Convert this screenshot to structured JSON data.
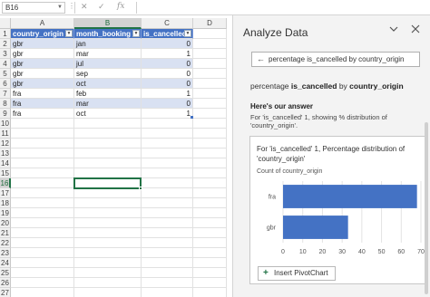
{
  "formula_bar": {
    "name_box": "B16",
    "more": "⋮",
    "cancel_icon": "✕",
    "enter_icon": "✓",
    "fx_label": "fx",
    "formula": ""
  },
  "columns": [
    "A",
    "B",
    "C",
    "D"
  ],
  "rows": [
    "1",
    "2",
    "3",
    "4",
    "5",
    "6",
    "7",
    "8",
    "9",
    "10",
    "11",
    "12",
    "13",
    "14",
    "15",
    "16",
    "17",
    "18",
    "19",
    "20",
    "21",
    "22",
    "23",
    "24",
    "25",
    "26",
    "27"
  ],
  "table": {
    "headers": [
      "country_origin",
      "month_booking",
      "is_cancelled"
    ],
    "data": [
      [
        "gbr",
        "jan",
        "0"
      ],
      [
        "gbr",
        "mar",
        "1"
      ],
      [
        "gbr",
        "jul",
        "0"
      ],
      [
        "gbr",
        "sep",
        "0"
      ],
      [
        "gbr",
        "oct",
        "0"
      ],
      [
        "fra",
        "feb",
        "1"
      ],
      [
        "fra",
        "mar",
        "0"
      ],
      [
        "fra",
        "oct",
        "1"
      ]
    ]
  },
  "active_cell": "B16",
  "pane": {
    "title": "Analyze Data",
    "collapse_icon": "chevron-down-icon",
    "close_icon": "close-icon",
    "search_value": "percentage is_cancelled by country_origin",
    "query_prefix": "percentage ",
    "query_bold1": "is_cancelled",
    "query_mid": " by ",
    "query_bold2": "country_origin",
    "answer_heading": "Here's our answer",
    "answer_desc": "For 'is_cancelled' 1, showing % distribution of 'country_origin'.",
    "card_title": "For 'is_cancelled' 1, Percentage distribution of 'country_origin'",
    "card_subtitle": "Count of country_origin",
    "pivot_button": "Insert PivotChart"
  },
  "colors": {
    "header_blue": "#4472c4",
    "band_blue": "#d9e1f2",
    "excel_green": "#217346",
    "bar_blue": "#4472c4"
  },
  "chart_data": {
    "type": "bar",
    "orientation": "horizontal",
    "categories": [
      "fra",
      "gbr"
    ],
    "values": [
      68,
      33
    ],
    "title": "For 'is_cancelled' 1, Percentage distribution of 'country_origin'",
    "xlabel": "",
    "ylabel": "",
    "xlim": [
      0,
      70
    ],
    "xticks": [
      "0",
      "10",
      "20",
      "30",
      "40",
      "50",
      "60",
      "70"
    ],
    "grid": true
  }
}
